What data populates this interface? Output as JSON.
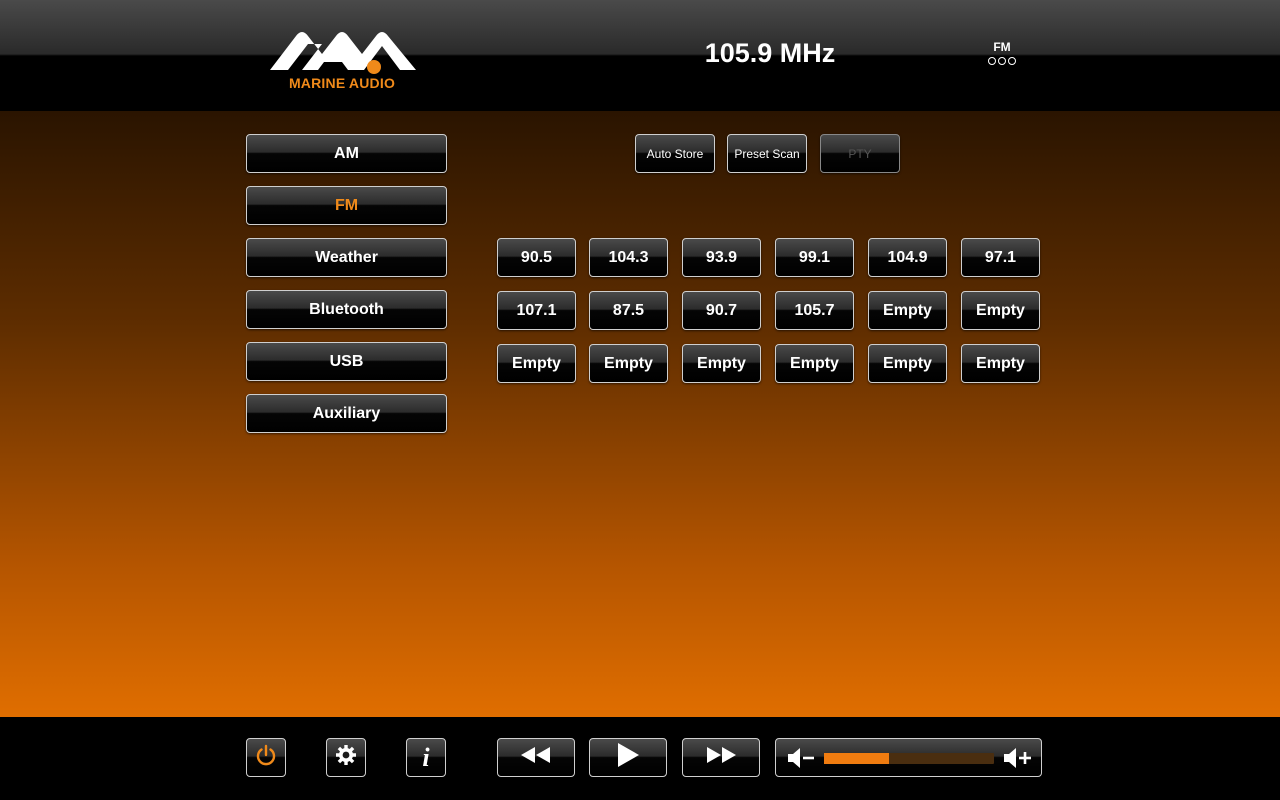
{
  "header": {
    "logo_text": "MARINE AUDIO",
    "frequency": "105.9 MHz",
    "band_indicator": "FM"
  },
  "sources": [
    {
      "label": "AM",
      "active": false
    },
    {
      "label": "FM",
      "active": true
    },
    {
      "label": "Weather",
      "active": false
    },
    {
      "label": "Bluetooth",
      "active": false
    },
    {
      "label": "USB",
      "active": false
    },
    {
      "label": "Auxiliary",
      "active": false
    }
  ],
  "actions": {
    "auto_store": "Auto Store",
    "preset_scan": "Preset Scan",
    "pty": "PTY"
  },
  "presets": [
    [
      "90.5",
      "104.3",
      "93.9",
      "99.1",
      "104.9",
      "97.1"
    ],
    [
      "107.1",
      "87.5",
      "90.7",
      "105.7",
      "Empty",
      "Empty"
    ],
    [
      "Empty",
      "Empty",
      "Empty",
      "Empty",
      "Empty",
      "Empty"
    ]
  ],
  "footer": {
    "info_label": "i",
    "volume_level": 0.38
  },
  "colors": {
    "accent": "#f08a1a",
    "background_top": "#2a1400",
    "background_bottom": "#e06e00"
  },
  "icons": {
    "power": "power-icon",
    "settings": "gear-icon",
    "info": "info-icon",
    "rewind": "rewind-icon",
    "play": "play-icon",
    "fast_forward": "fast-forward-icon",
    "volume_down": "volume-down-icon",
    "volume_up": "volume-up-icon"
  }
}
